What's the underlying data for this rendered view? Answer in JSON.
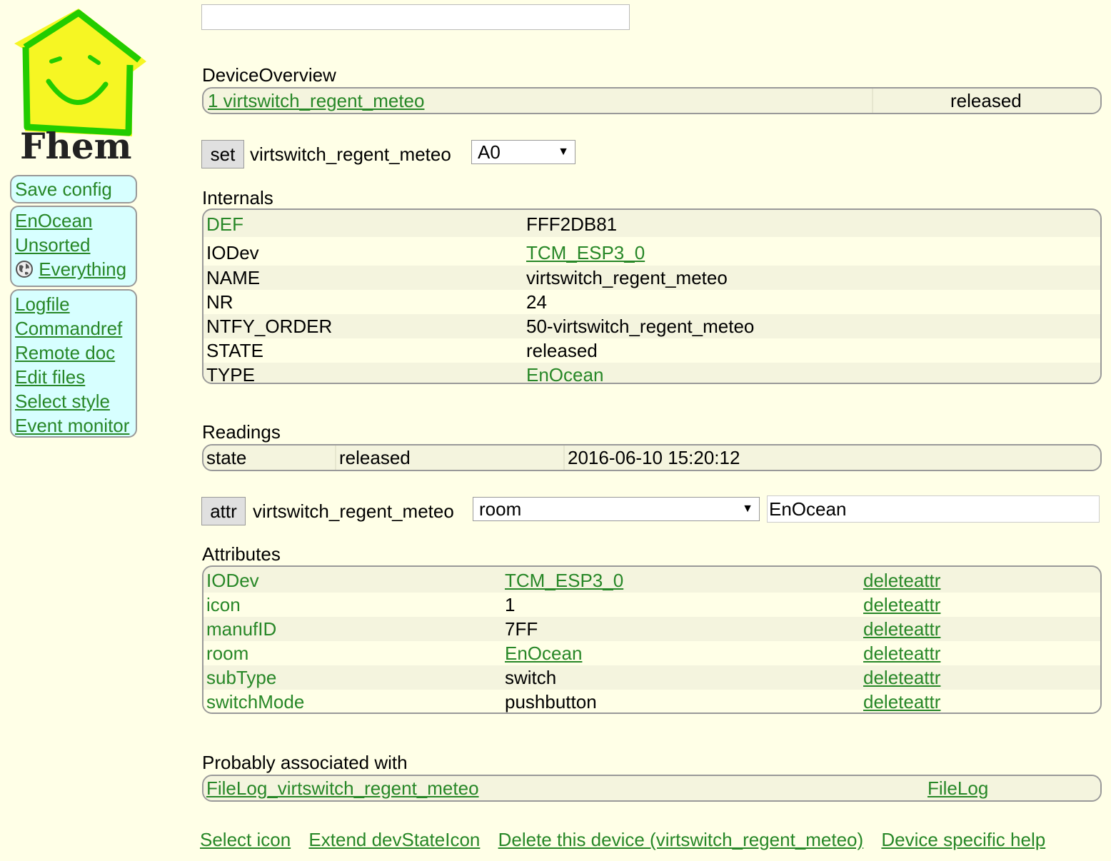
{
  "logo": {
    "text": "Fhem"
  },
  "sidebar": {
    "save_config": "Save config",
    "rooms": [
      "EnOcean",
      "Unsorted",
      "Everything"
    ],
    "tools": [
      "Logfile",
      "Commandref",
      "Remote doc",
      "Edit files",
      "Select style",
      "Event monitor"
    ]
  },
  "search": {
    "value": ""
  },
  "overview": {
    "title": "DeviceOverview",
    "device_link": "1 virtswitch_regent_meteo",
    "state": "released"
  },
  "set_cmd": {
    "button": "set",
    "device": "virtswitch_regent_meteo",
    "selected": "A0"
  },
  "internals": {
    "title": "Internals",
    "rows": [
      {
        "key": "DEF",
        "value": "FFF2DB81"
      },
      {
        "key": "IODev",
        "value": "TCM_ESP3_0"
      },
      {
        "key": "NAME",
        "value": "virtswitch_regent_meteo"
      },
      {
        "key": "NR",
        "value": "24"
      },
      {
        "key": "NTFY_ORDER",
        "value": "50-virtswitch_regent_meteo"
      },
      {
        "key": "STATE",
        "value": "released"
      },
      {
        "key": "TYPE",
        "value": "EnOcean"
      }
    ]
  },
  "readings": {
    "title": "Readings",
    "rows": [
      {
        "name": "state",
        "value": "released",
        "time": "2016-06-10 15:20:12"
      }
    ]
  },
  "attr_cmd": {
    "button": "attr",
    "device": "virtswitch_regent_meteo",
    "selected": "room",
    "value": "EnOcean"
  },
  "attributes": {
    "title": "Attributes",
    "delete_label": "deleteattr",
    "rows": [
      {
        "key": "IODev",
        "value": "TCM_ESP3_0"
      },
      {
        "key": "icon",
        "value": "1"
      },
      {
        "key": "manufID",
        "value": "7FF"
      },
      {
        "key": "room",
        "value": "EnOcean"
      },
      {
        "key": "subType",
        "value": "switch"
      },
      {
        "key": "switchMode",
        "value": "pushbutton"
      }
    ]
  },
  "associated": {
    "title": "Probably associated with",
    "name": "FileLog_virtswitch_regent_meteo",
    "type": "FileLog"
  },
  "bottom_links": [
    "Select icon",
    "Extend devStateIcon",
    "Delete this device (virtswitch_regent_meteo)",
    "Device specific help"
  ]
}
